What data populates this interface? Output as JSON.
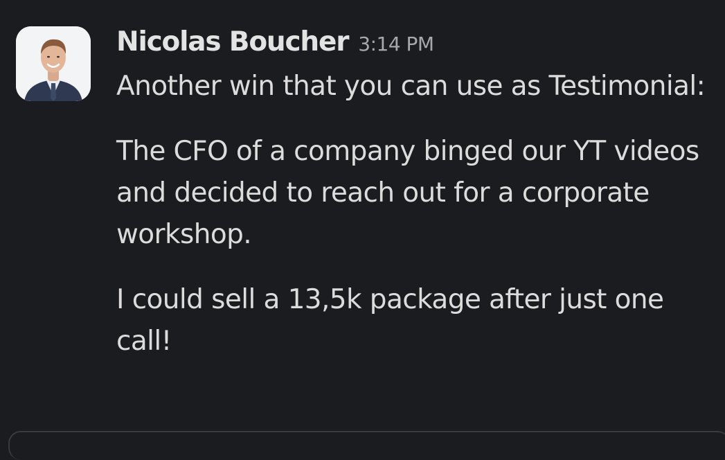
{
  "message": {
    "sender": "Nicolas Boucher",
    "timestamp": "3:14 PM",
    "paragraphs": [
      "Another win that you can use as Testimonial:",
      "The CFO of a company binged our YT videos and decided to reach out for a corporate workshop.",
      "I could sell a 13,5k package after just one call!"
    ]
  },
  "colors": {
    "background": "#1b1c20",
    "text": "#dcdcdd",
    "timestamp": "#a8a8aa"
  }
}
